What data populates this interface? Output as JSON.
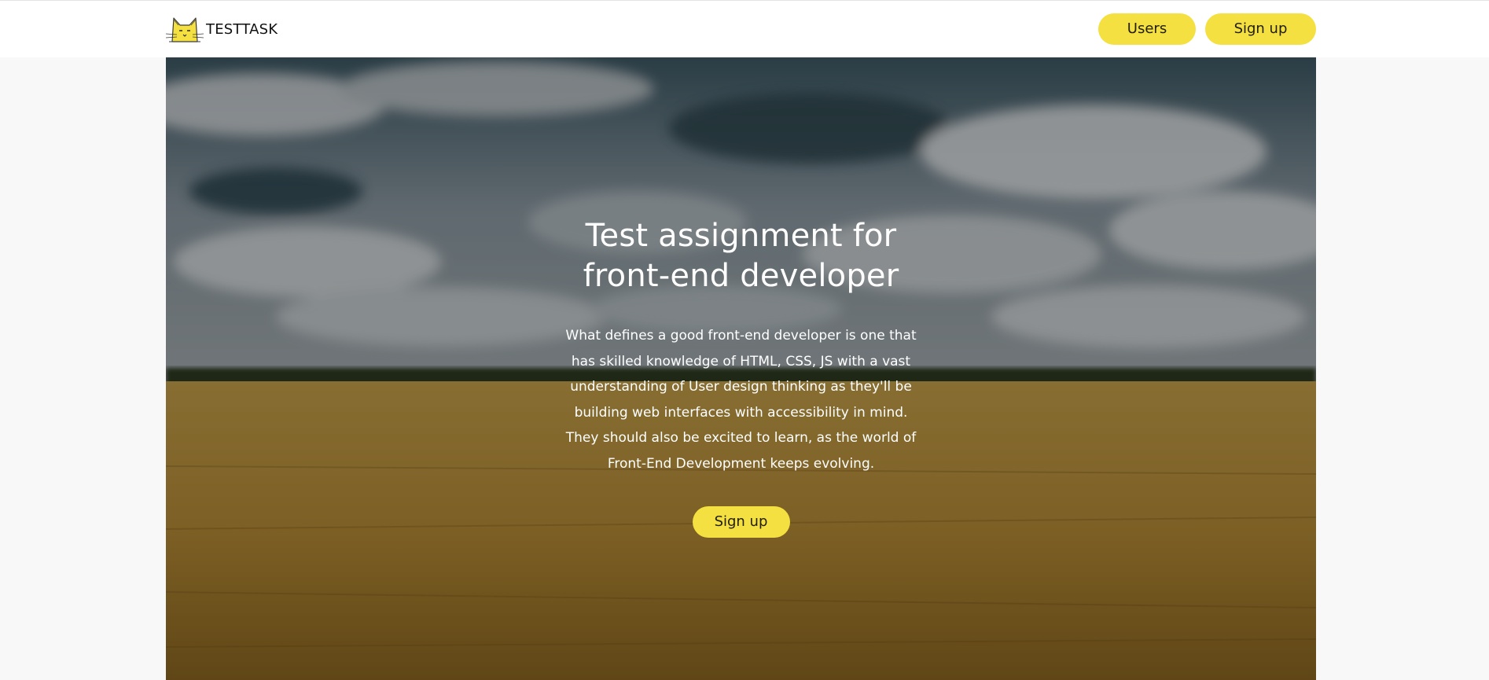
{
  "header": {
    "logo_text": "TESTTASK",
    "logo_icon": "cat-logo-icon",
    "nav": {
      "users_label": "Users",
      "signup_label": "Sign up"
    }
  },
  "hero": {
    "title_line1": "Test assignment for",
    "title_line2": "front-end developer",
    "text_lines": [
      "What defines a good front-end developer is one that",
      "has skilled knowledge of HTML, CSS, JS with a vast",
      "understanding of User design thinking as they'll be",
      "building web interfaces with accessibility in mind.",
      "They should also be excited to learn, as the world of",
      "Front-End Development keeps evolving."
    ],
    "button_label": "Sign up",
    "background": "wheat-field-under-cloudy-sky"
  },
  "colors": {
    "accent": "#f4e041",
    "page_background": "#f8f8f8",
    "header_background": "#ffffff",
    "hero_text": "#ffffff"
  }
}
